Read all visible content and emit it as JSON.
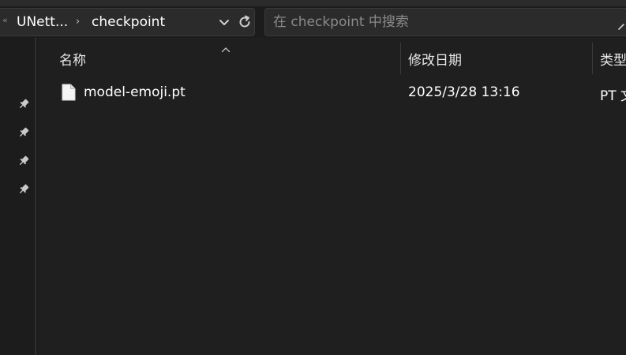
{
  "breadcrumb": {
    "overflow": "«",
    "segments": [
      "UNett...",
      "checkpoint"
    ],
    "separator": "›"
  },
  "search": {
    "placeholder": "在 checkpoint 中搜索"
  },
  "columns": [
    "名称",
    "修改日期",
    "类型"
  ],
  "files": [
    {
      "name": "model-emoji.pt",
      "modified": "2025/3/28 13:16",
      "type": "PT 文"
    }
  ],
  "icons": {
    "refresh": "refresh-icon",
    "dropdown": "chevron-down-icon",
    "pin": "pin-icon",
    "file": "file-icon",
    "sort": "sort-up-icon"
  }
}
